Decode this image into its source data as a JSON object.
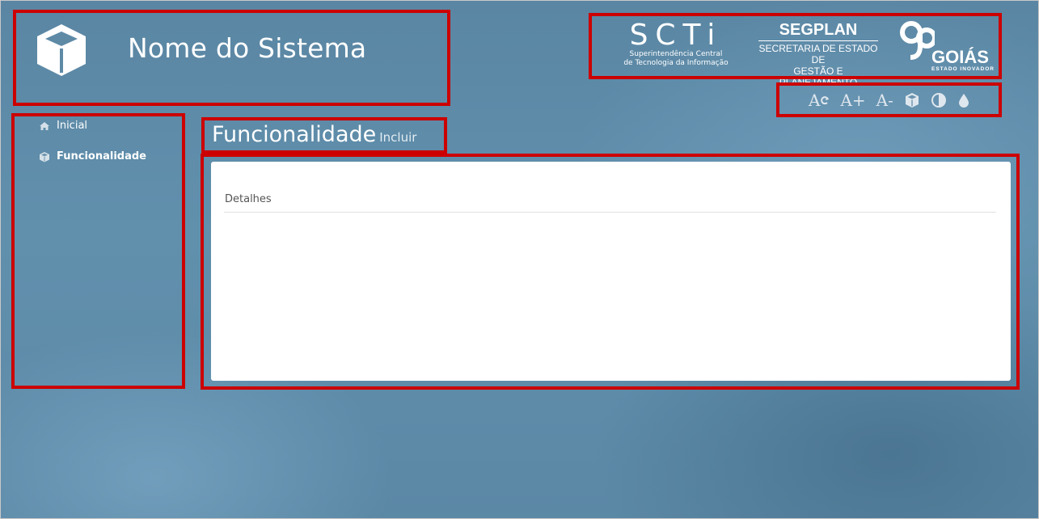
{
  "header": {
    "system_name": "Nome do Sistema",
    "logo_icon": "cube-icon"
  },
  "brands": {
    "scti": {
      "big": "SCTi",
      "line1": "Superintendência Central",
      "line2": "de Tecnologia da Informação"
    },
    "segplan": {
      "big": "SEGPLAN",
      "line1": "SECRETARIA DE ESTADO DE",
      "line2": "GESTÃO E PLANEJAMENTO"
    },
    "goias": {
      "word": "GOIÁS",
      "tag": "ESTADO INOVADOR"
    }
  },
  "toolbar": {
    "reset": "A",
    "increase": "A+",
    "decrease": "A-",
    "icons": [
      "font-reset-icon",
      "font-increase-icon",
      "font-decrease-icon",
      "cube-icon",
      "contrast-icon",
      "drop-icon"
    ]
  },
  "sidebar": {
    "items": [
      {
        "label": "Inicial",
        "icon": "home-icon"
      },
      {
        "label": "Funcionalidade",
        "icon": "cube-icon"
      }
    ]
  },
  "page": {
    "title": "Funcionalidade",
    "subtitle": "Incluir"
  },
  "panel": {
    "section_label": "Detalhes"
  },
  "colors": {
    "background": "#5e8aa6",
    "highlight": "#cc0000",
    "panel": "#ffffff"
  }
}
